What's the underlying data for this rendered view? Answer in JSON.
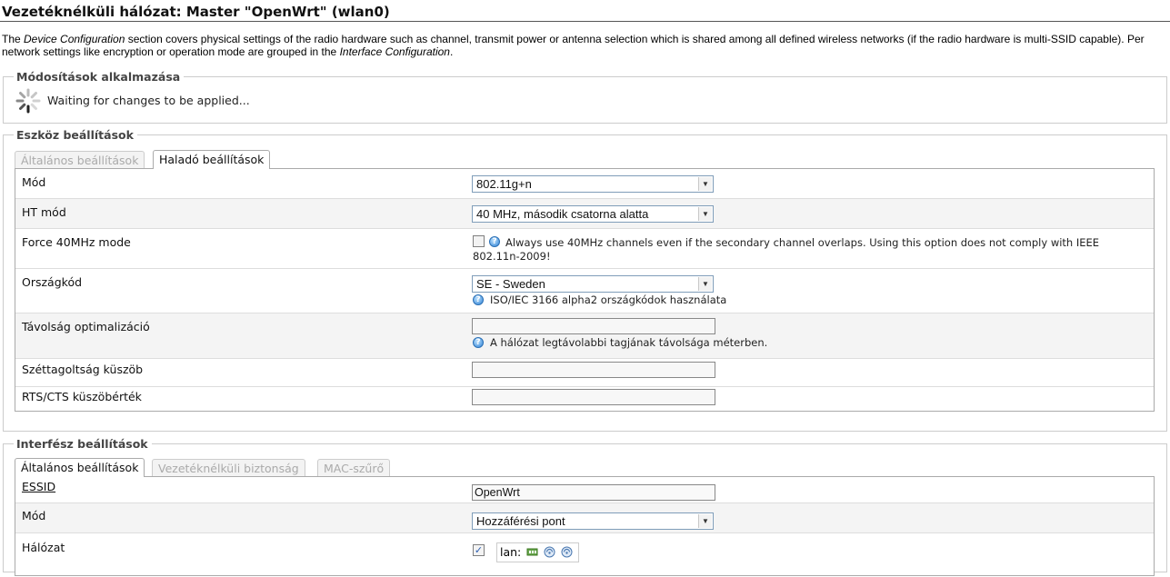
{
  "title": "Vezetéknélküli hálózat: Master \"OpenWrt\" (wlan0)",
  "intro": {
    "p1": "The ",
    "em1": "Device Configuration",
    "p2": " section covers physical settings of the radio hardware such as channel, transmit power or antenna selection which is shared among all defined wireless networks (if the radio hardware is multi-SSID capable). Per network settings like encryption or operation mode are grouped in the ",
    "em2": "Interface Configuration",
    "p3": "."
  },
  "apply": {
    "legend": "Módosítások alkalmazása",
    "status": "Waiting for changes to be applied..."
  },
  "device": {
    "legend": "Eszköz beállítások",
    "tabs": [
      "Általános beállítások",
      "Haladó beállítások"
    ],
    "mode_label": "Mód",
    "mode_value": "802.11g+n",
    "htmode_label": "HT mód",
    "htmode_value": "40 MHz, második csatorna alatta",
    "force40_label": "Force 40MHz mode",
    "force40_help": "Always use 40MHz channels even if the secondary channel overlaps. Using this option does not comply with IEEE 802.11n-2009!",
    "country_label": "Országkód",
    "country_value": "SE - Sweden",
    "country_help": "ISO/IEC 3166 alpha2 országkódok használata",
    "distance_label": "Távolság optimalizáció",
    "distance_value": "",
    "distance_help": "A hálózat legtávolabbi tagjának távolsága méterben.",
    "frag_label": "Széttagoltság küszöb",
    "frag_value": "",
    "rts_label": "RTS/CTS küszöbérték",
    "rts_value": ""
  },
  "iface": {
    "legend": "Interfész beállítások",
    "tabs": [
      "Általános beállítások",
      "Vezetéknélküli biztonság",
      "MAC-szűrő"
    ],
    "essid_label": "ESSID",
    "essid_value": "OpenWrt",
    "mode_label": "Mód",
    "mode_value": "Hozzáférési pont",
    "network_label": "Hálózat",
    "network_item": "lan:"
  },
  "colors": {
    "border": "#cccccc",
    "alt_row": "#f4f4f4",
    "help_icon": "#2e82d6"
  },
  "icons": [
    "spinner-icon",
    "help-icon",
    "checkbox-checked-icon",
    "ethernet-icon",
    "wireless-icon"
  ]
}
